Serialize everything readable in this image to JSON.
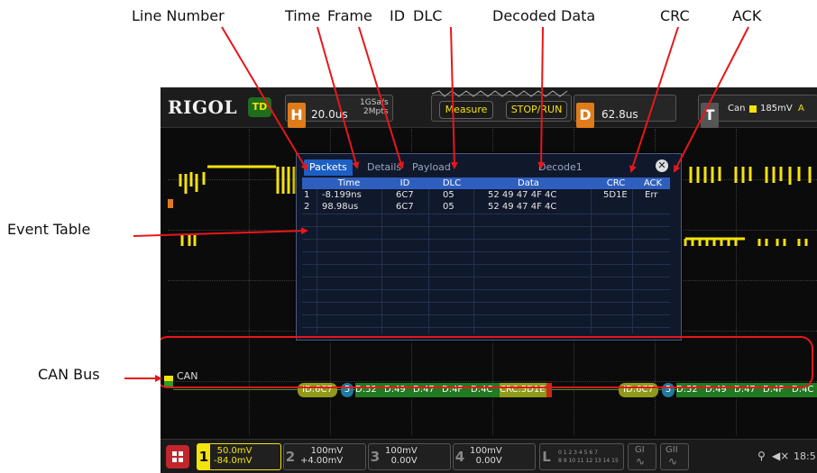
{
  "callouts": {
    "line_number": "Line Number",
    "time": "Time",
    "frame": "Frame",
    "id": "ID",
    "dlc": "DLC",
    "decoded_data": "Decoded Data",
    "crc": "CRC",
    "ack": "ACK",
    "event_table": "Event Table",
    "can_bus": "CAN Bus"
  },
  "scope": {
    "logo": "RIGOL",
    "mode_badge": "TD",
    "h_letter": "H",
    "h_value": "20.0us",
    "sample_rate": "1GSa/s",
    "mem_depth": "2Mpts",
    "measure_label": "Measure",
    "run_label": "STOP/RUN",
    "d_letter": "D",
    "d_value": "62.8us",
    "t_letter": "T",
    "trigger_source": "Can",
    "trigger_level": "185mV",
    "trigger_channel_short": "A"
  },
  "event_table": {
    "tabs": [
      "Packets",
      "Details",
      "Payload",
      "Decode1"
    ],
    "columns": [
      "Time",
      "ID",
      "DLC",
      "Data",
      "CRC",
      "ACK"
    ],
    "rows": [
      {
        "line": "1",
        "time": "-8.199ns",
        "id": "6C7",
        "dlc": "05",
        "data": "52 49 47 4F 4C",
        "crc": "5D1E",
        "ack": "Err"
      },
      {
        "line": "2",
        "time": "98.98us",
        "id": "6C7",
        "dlc": "05",
        "data": "52 49 47 4F 4C",
        "crc": "",
        "ack": ""
      }
    ]
  },
  "bus": {
    "label": "CAN",
    "frame1": [
      "ID:6C7",
      "5",
      "D:52",
      "D:49",
      "D:47",
      "D:4F",
      "D:4C",
      "CRC:5D1E"
    ],
    "frame2": [
      "ID:6C7",
      "5",
      "D:52",
      "D:49",
      "D:47",
      "D:4F",
      "D:4C"
    ]
  },
  "bottom": {
    "ch1": {
      "num": "1",
      "scale": "50.0mV",
      "offset": "-84.0mV"
    },
    "ch2": {
      "num": "2",
      "scale": "100mV",
      "offset": "+4.00mV"
    },
    "ch3": {
      "num": "3",
      "scale": "100mV",
      "offset": "0.00V"
    },
    "ch4": {
      "num": "4",
      "scale": "100mV",
      "offset": "0.00V"
    },
    "la": {
      "letter": "L",
      "row1": "0 1 2 3  4 5 6 7",
      "row2": "8 9 10 11 12 13 14 15"
    },
    "g1": "GI",
    "g2": "GII",
    "time": "18:5"
  },
  "colors": {
    "annotation_red": "#e8161a",
    "ch1_yellow": "#f4e20c",
    "bus_green": "#2f9a2f",
    "table_header_blue": "#2f5fbe"
  }
}
